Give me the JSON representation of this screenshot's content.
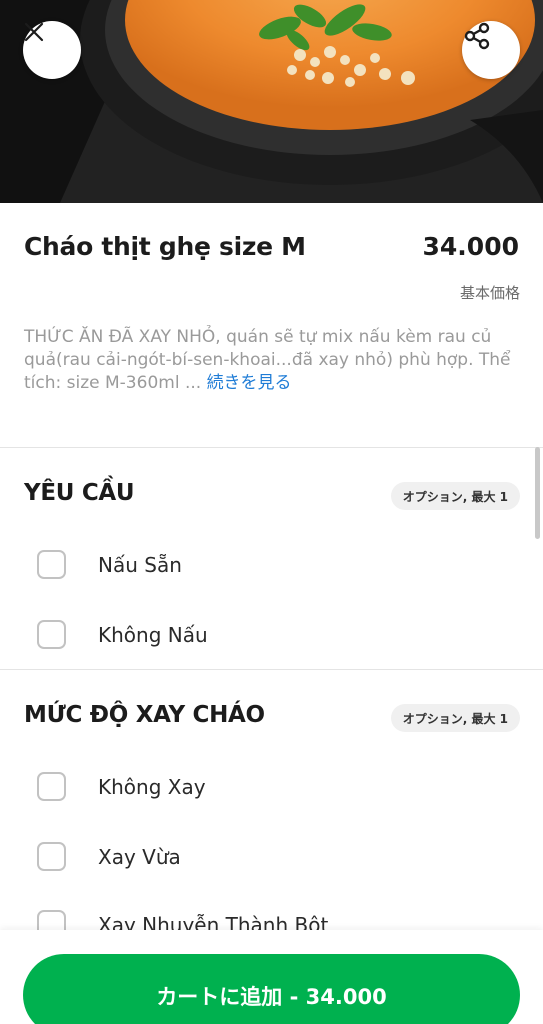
{
  "header": {
    "close_icon": "close-icon",
    "share_icon": "share-icon"
  },
  "product": {
    "name": "Cháo thịt ghẹ size M",
    "price": "34.000",
    "base_price_label": "基本価格",
    "description": "THỨC ĂN ĐÃ XAY NHỎ, quán sẽ tự mix nấu kèm rau củ quả(rau cải-ngót-bí-sen-khoai...đã xay nhỏ) phù hợp. Thể tích: size M-360ml ...",
    "see_more": "続きを見る"
  },
  "sections": [
    {
      "title": "YÊU CẦU",
      "badge": "オプション, 最大 1",
      "options": [
        {
          "label": "Nấu Sẵn",
          "checked": false
        },
        {
          "label": "Không Nấu",
          "checked": false
        }
      ]
    },
    {
      "title": "MỨC ĐỘ XAY CHÁO",
      "badge": "オプション, 最大 1",
      "options": [
        {
          "label": "Không Xay",
          "checked": false
        },
        {
          "label": "Xay Vừa",
          "checked": false
        },
        {
          "label": "Xay Nhuyễn Thành Bột",
          "checked": false
        }
      ]
    }
  ],
  "cart_button": {
    "label": "カートに追加 - 34.000"
  },
  "colors": {
    "accent": "#00b14f",
    "link": "#1f7cd6"
  }
}
